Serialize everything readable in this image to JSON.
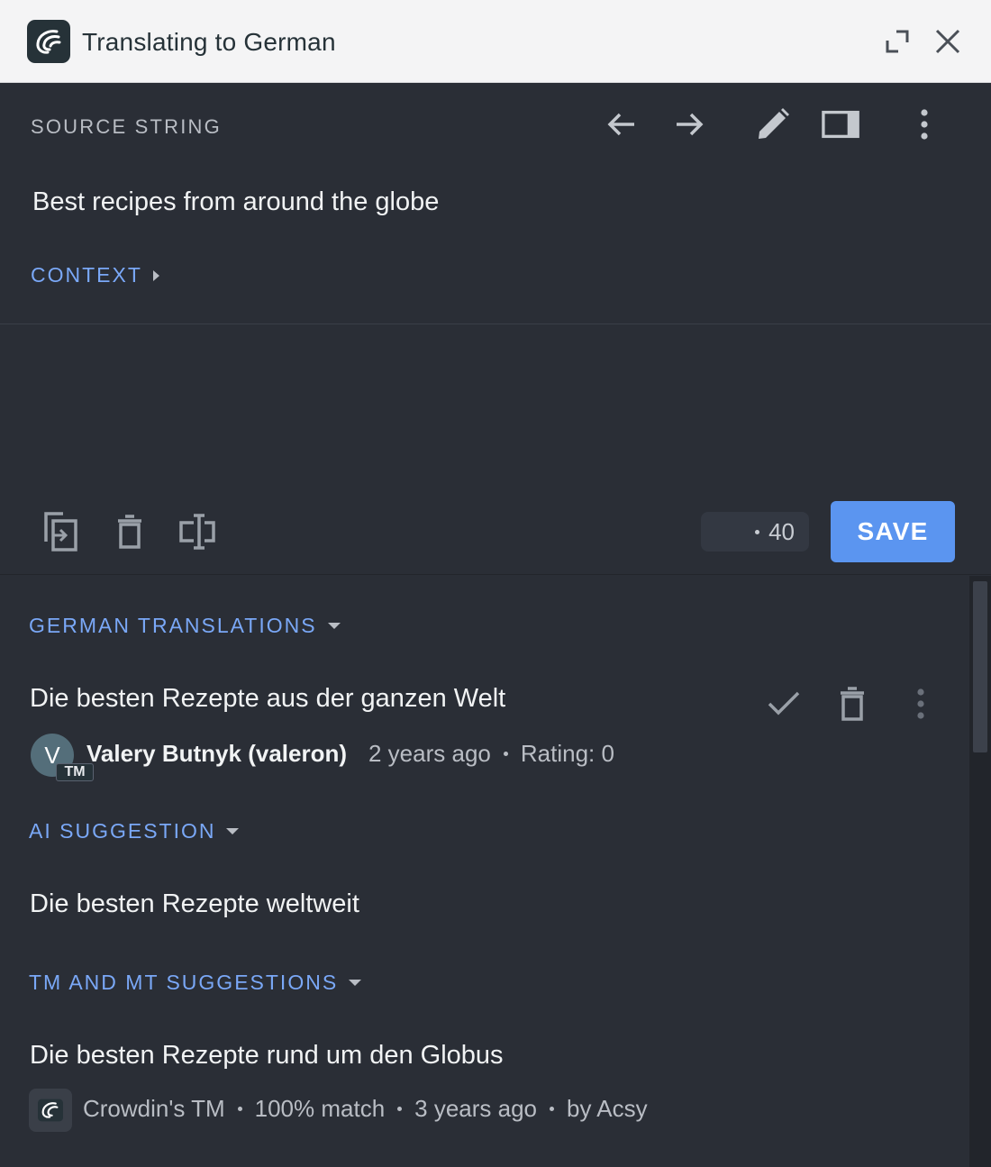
{
  "window": {
    "title": "Translating to German"
  },
  "source": {
    "caption": "SOURCE STRING",
    "text": "Best recipes from around the globe",
    "context_label": "CONTEXT"
  },
  "editor": {
    "char_count": "40",
    "save_label": "SAVE"
  },
  "groups": {
    "translations": {
      "header": "GERMAN TRANSLATIONS",
      "items": [
        {
          "text": "Die besten Rezepte aus der ganzen Welt",
          "avatar_letter": "V",
          "badge": "TM",
          "author": "Valery Butnyk (valeron)",
          "time": "2 years ago",
          "rating": "Rating: 0"
        }
      ]
    },
    "ai": {
      "header": "AI SUGGESTION",
      "text": "Die besten Rezepte weltweit"
    },
    "tm_mt": {
      "header": "TM AND MT SUGGESTIONS",
      "items": [
        {
          "text": "Die besten Rezepte rund um den Globus",
          "source": "Crowdin's TM",
          "match": "100% match",
          "time": "3 years ago",
          "by": "by Acsy"
        }
      ]
    }
  },
  "icons": {
    "app_logo": "crowdin-logo-icon",
    "expand": "expand-icon",
    "close": "close-icon",
    "prev": "arrow-left-icon",
    "next": "arrow-right-icon",
    "edit": "pencil-icon",
    "layout": "panel-layout-icon",
    "more": "more-vertical-icon",
    "copy_source": "copy-source-icon",
    "clear": "trash-icon",
    "ai_assist": "text-cursor-icon",
    "approve": "check-icon"
  },
  "colors": {
    "accent": "#5b95f0",
    "link": "#7aa8f7",
    "background": "#2a2e36",
    "titlebar": "#f4f4f5"
  }
}
